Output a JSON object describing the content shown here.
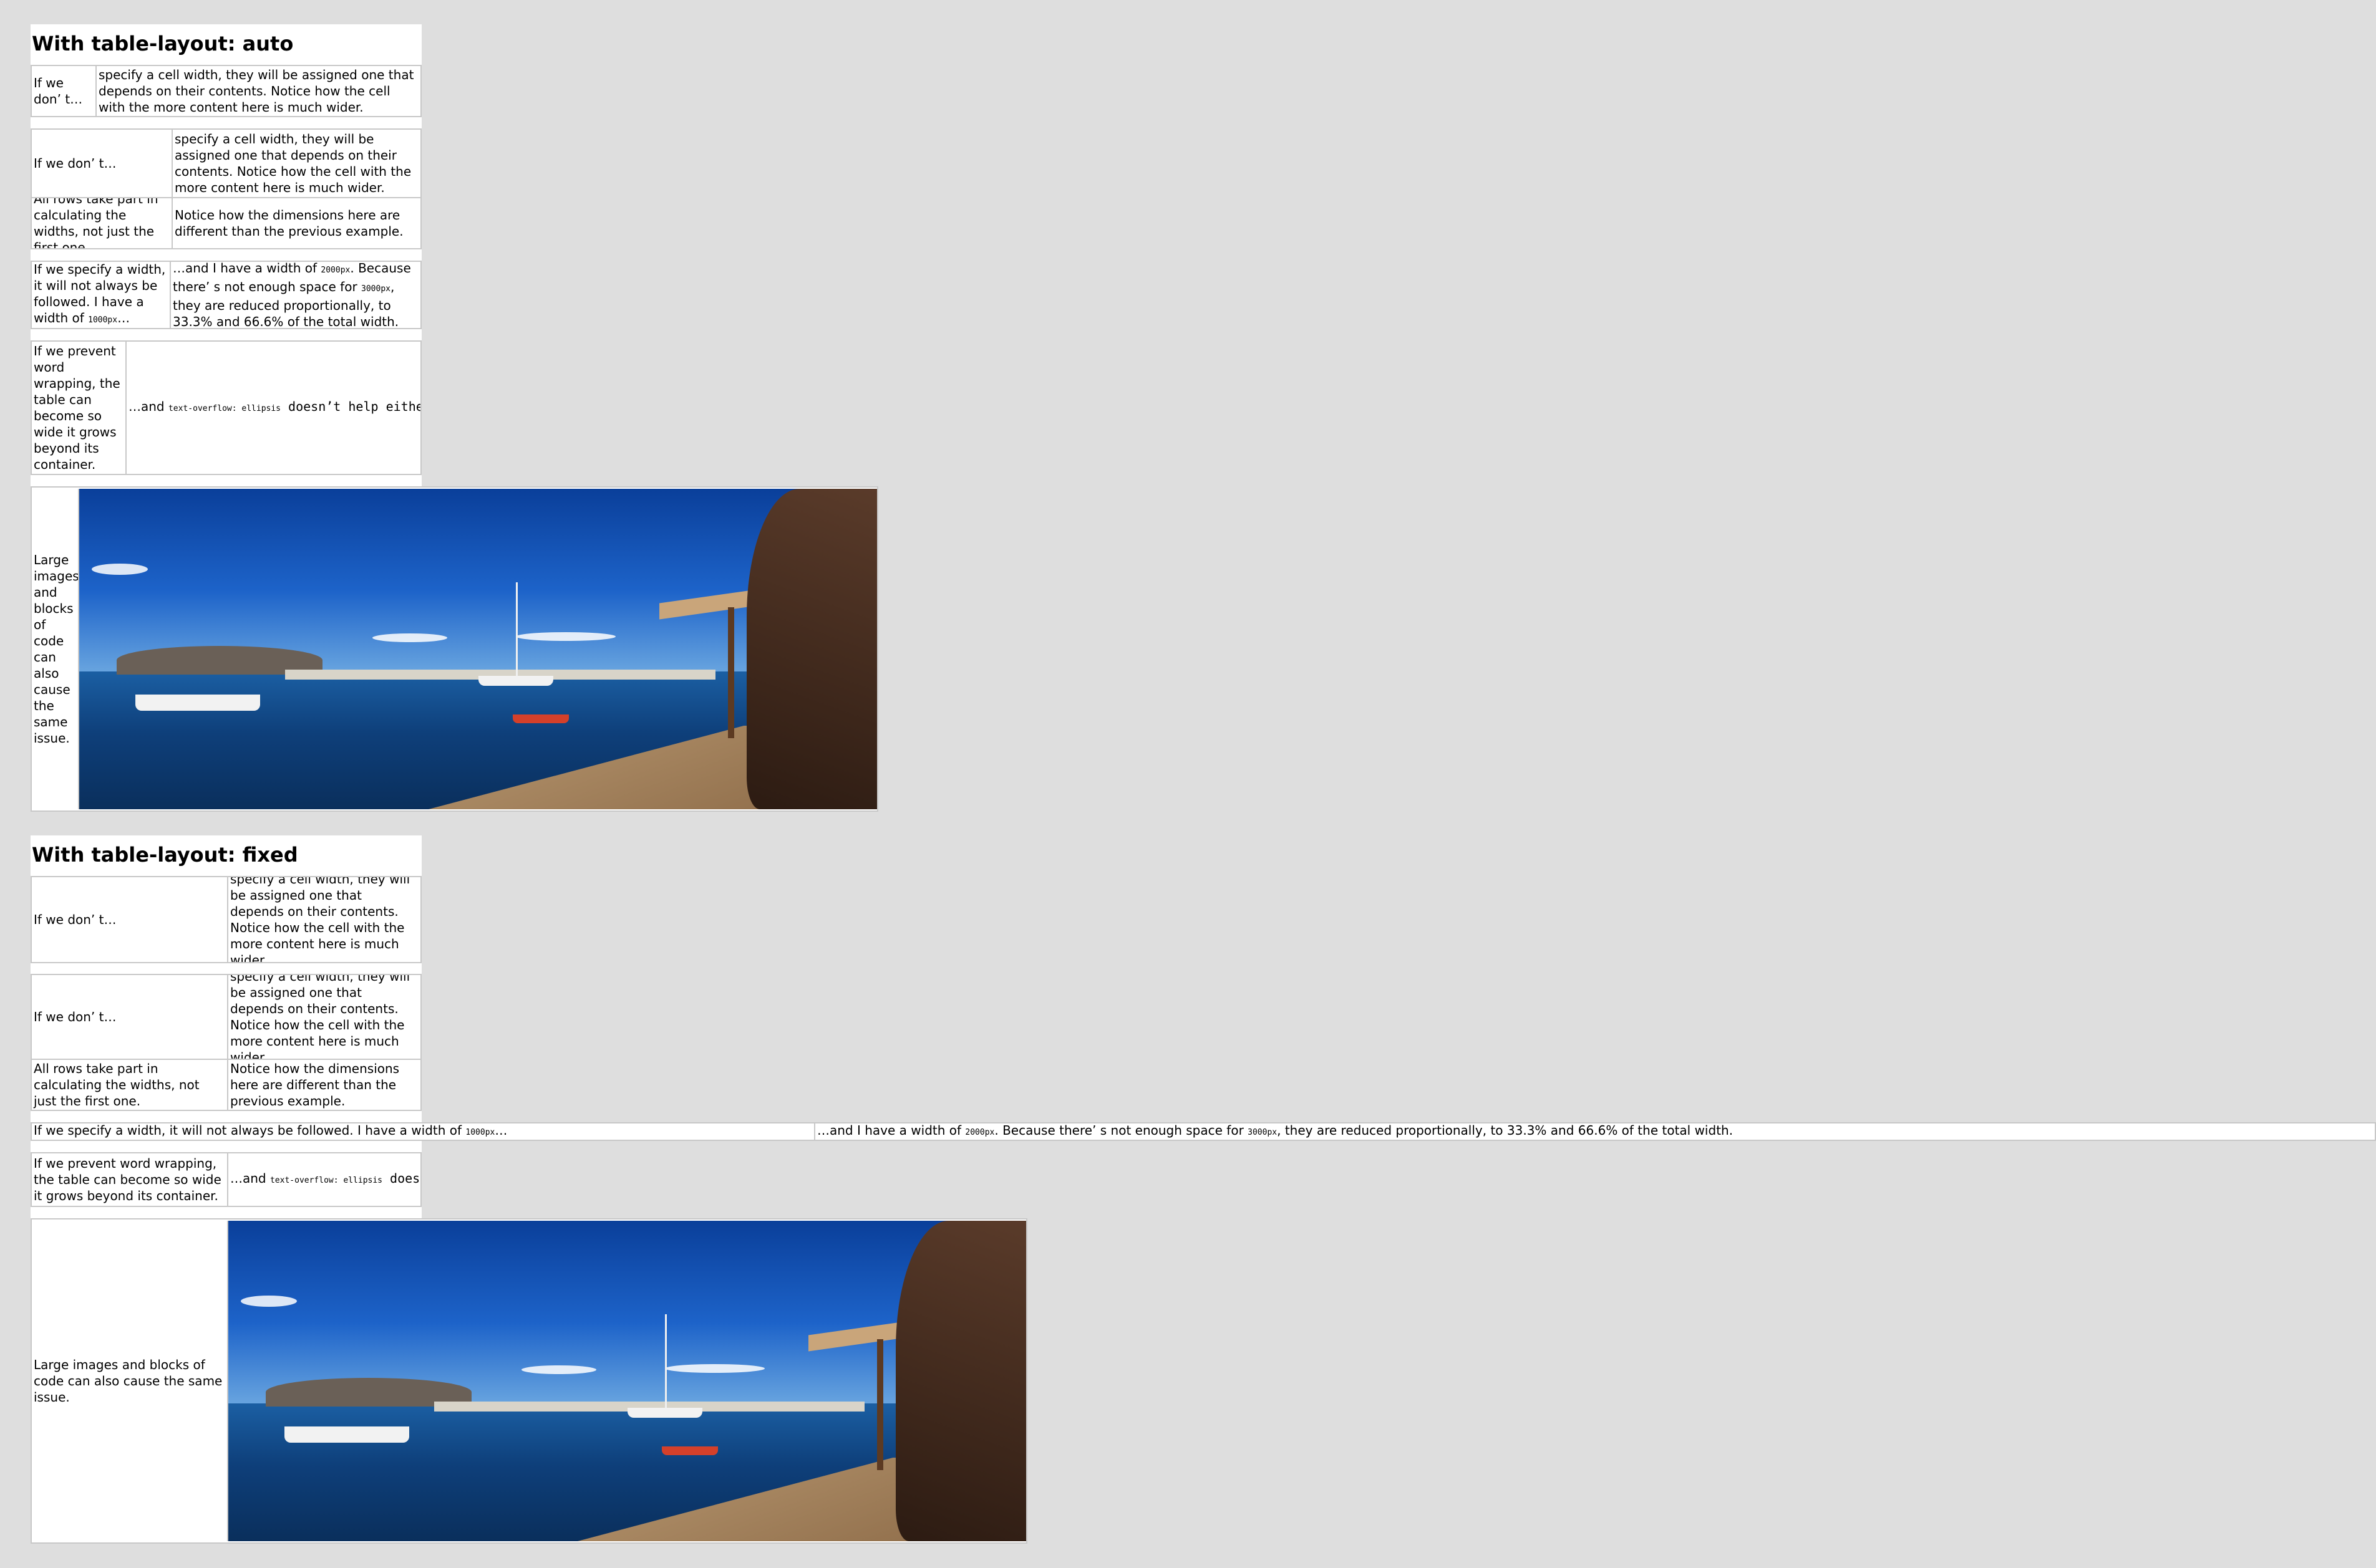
{
  "auto": {
    "heading": "With table-layout: auto",
    "t1": {
      "c1": "If we don’ t…",
      "c2": "specify a cell width, they will be assigned one that depends on their contents. Notice how the cell with the more content here is much wider."
    },
    "t2": {
      "r1c1": "If we don’ t…",
      "r1c2": "specify a cell width, they will be assigned one that depends on their contents. Notice how the cell with the more content here is much wider.",
      "r2c1": "All rows take part in calculating the widths, not just the first one.",
      "r2c2": "Notice how the dimensions here are different than the previous example."
    },
    "t3": {
      "c1_a": "If we specify a width, it will not always be followed. I have a width of ",
      "c1_code": "1000px",
      "c1_b": "…",
      "c2_a": "…and I have a width of ",
      "c2_code1": "2000px",
      "c2_b": ". Because there’ s not enough space for ",
      "c2_code2": "3000px",
      "c2_c": ", they are reduced proportionally, to 33.3% and 66.6% of the total width."
    },
    "t4": {
      "c1": "If we prevent word wrapping, the table can become so wide it grows beyond its container.",
      "c2_a": "…and ",
      "c2_code": "text-overflow: ellipsis",
      "c2_b": " doesn’t help either."
    },
    "t5": {
      "c1": "Large images and blocks of code can also cause the same issue."
    }
  },
  "fixed": {
    "heading": "With table-layout: fixed",
    "t1": {
      "c1": "If we don’ t…",
      "c2": "specify a cell width, they will be assigned one that depends on their contents. Notice how the cell with the more content here is much wider."
    },
    "t2": {
      "r1c1": "If we don’ t…",
      "r1c2": "specify a cell width, they will be assigned one that depends on their contents. Notice how the cell with the more content here is much wider.",
      "r2c1": "All rows take part in calculating the widths, not just the first one.",
      "r2c2": "Notice how the dimensions here are different than the previous example."
    },
    "t3": {
      "c1_a": "If we specify a width, it will not always be followed. I have a width of ",
      "c1_code": "1000px",
      "c1_b": "…",
      "c2_a": "…and I have a width of ",
      "c2_code1": "2000px",
      "c2_b": ". Because there’ s not enough space for ",
      "c2_code2": "3000px",
      "c2_c": ", they are reduced proportionally, to 33.3% and 66.6% of the total width."
    },
    "t4": {
      "c1": "If we prevent word wrapping, the table can become so wide it grows beyond its container.",
      "c2_a": "…and ",
      "c2_code": "text-overflow: ellipsis",
      "c2_b": " does…"
    },
    "t5": {
      "c1": "Large images and blocks of code can also cause the same issue."
    }
  }
}
